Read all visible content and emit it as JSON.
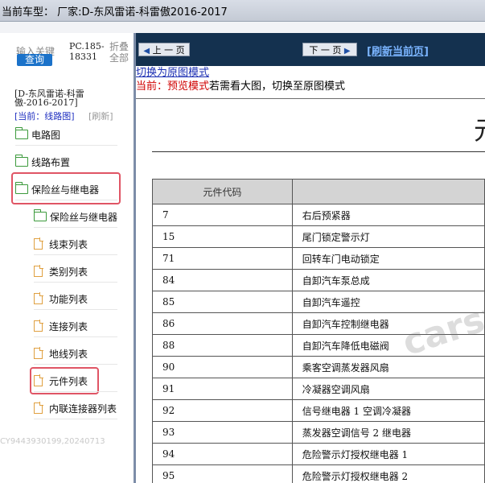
{
  "title_bar": {
    "text": "当前车型：  厂家:D-东风雷诺-科雷傲2016-2017"
  },
  "sidebar": {
    "search_hint": "输入关键",
    "search_button": "查询",
    "pc_code": "PC.185-18331",
    "collapse_all": "折叠全部",
    "model_name": "[D-东风雷诺-科雷傲-2016-2017]",
    "current_view": "[当前：线路图]",
    "refresh": "[刷新]",
    "items": [
      {
        "label": "电路图",
        "icon": "folder-icon"
      },
      {
        "label": "线路布置",
        "icon": "folder-icon"
      },
      {
        "label": "保险丝与继电器",
        "icon": "folder-open-icon"
      },
      {
        "label": "保险丝与继电器",
        "icon": "folder-icon"
      },
      {
        "label": "线束列表",
        "icon": "file-icon"
      },
      {
        "label": "类别列表",
        "icon": "file-icon"
      },
      {
        "label": "功能列表",
        "icon": "file-icon"
      },
      {
        "label": "连接列表",
        "icon": "file-icon"
      },
      {
        "label": "地线列表",
        "icon": "file-icon"
      },
      {
        "label": "元件列表",
        "icon": "file-icon"
      },
      {
        "label": "内联连接器列表",
        "icon": "file-icon"
      }
    ],
    "watermark": "CY9443930199,20240713"
  },
  "toolbar": {
    "prev_label": "上 一 页",
    "next_label": "下 一 页",
    "refresh_label": "[刷新当前页]"
  },
  "content": {
    "switch_link": "切换为原图模式",
    "preview_red": "当前：预览模式",
    "preview_text": "若需看大图，切换至原图模式",
    "doc_title": "元",
    "table": {
      "header": "元件代码",
      "rows": [
        {
          "code": "7",
          "name": "右后预紧器"
        },
        {
          "code": "15",
          "name": "尾门锁定警示灯"
        },
        {
          "code": "71",
          "name": "回转车门电动锁定"
        },
        {
          "code": "84",
          "name": "自卸汽车泵总成"
        },
        {
          "code": "85",
          "name": "自卸汽车遥控"
        },
        {
          "code": "86",
          "name": "自卸汽车控制继电器"
        },
        {
          "code": "88",
          "name": "自卸汽车降低电磁阀"
        },
        {
          "code": "90",
          "name": "乘客空调蒸发器风扇"
        },
        {
          "code": "91",
          "name": "冷凝器空调风扇"
        },
        {
          "code": "92",
          "name": "信号继电器 1 空调冷凝器"
        },
        {
          "code": "93",
          "name": "蒸发器空调信号 2 继电器"
        },
        {
          "code": "94",
          "name": "危险警示灯授权继电器 1"
        },
        {
          "code": "95",
          "name": "危险警示灯授权继电器 2"
        }
      ]
    },
    "watermark": "carsv"
  }
}
